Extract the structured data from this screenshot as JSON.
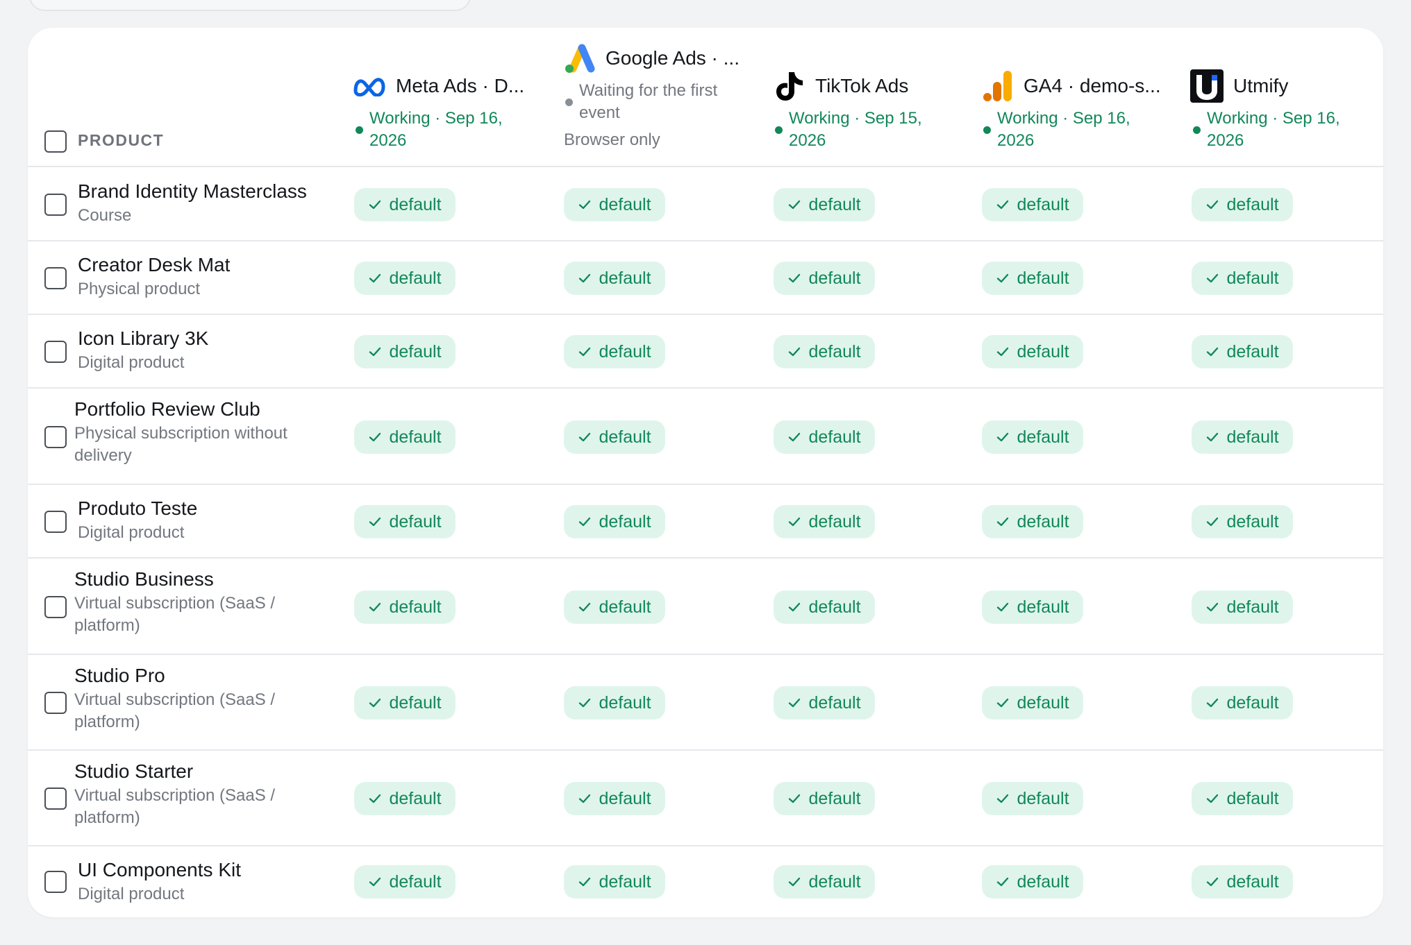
{
  "header": {
    "product_label": "PRODUCT",
    "columns": [
      {
        "name": "Meta Ads · D...",
        "status": "Working · Sep 16, 2026",
        "status_color": "#12875a",
        "icon": "meta-icon"
      },
      {
        "name": "Google Ads · ...",
        "status": "Waiting for the first event",
        "note": "Browser only",
        "status_color": "#8a8f97",
        "icon": "google-ads-icon"
      },
      {
        "name": "TikTok Ads",
        "status": "Working · Sep 15, 2026",
        "status_color": "#12875a",
        "icon": "tiktok-icon"
      },
      {
        "name": "GA4 · demo-s...",
        "status": "Working · Sep 16, 2026",
        "status_color": "#12875a",
        "icon": "ga4-icon"
      },
      {
        "name": "Utmify",
        "status": "Working · Sep 16, 2026",
        "status_color": "#12875a",
        "icon": "utmify-icon"
      }
    ]
  },
  "pill_label": "default",
  "colors": {
    "accent": "#12875a",
    "pill_bg": "#dff5eb",
    "muted": "#72777f"
  },
  "rows": [
    {
      "name": "Brand Identity Masterclass",
      "type": "Course"
    },
    {
      "name": "Creator Desk Mat",
      "type": "Physical product"
    },
    {
      "name": "Icon Library 3K",
      "type": "Digital product"
    },
    {
      "name": "Portfolio Review Club",
      "type": "Physical subscription without delivery"
    },
    {
      "name": "Produto Teste",
      "type": "Digital product"
    },
    {
      "name": "Studio Business",
      "type": "Virtual subscription (SaaS / platform)"
    },
    {
      "name": "Studio Pro",
      "type": "Virtual subscription (SaaS / platform)"
    },
    {
      "name": "Studio Starter",
      "type": "Virtual subscription (SaaS / platform)"
    },
    {
      "name": "UI Components Kit",
      "type": "Digital product"
    }
  ]
}
